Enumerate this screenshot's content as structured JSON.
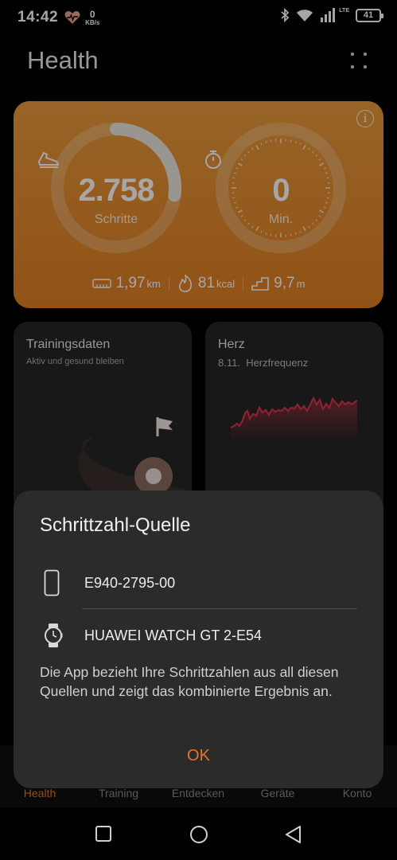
{
  "status_bar": {
    "time": "14:42",
    "net_speed_value": "0",
    "net_speed_unit": "KB/s",
    "network_type": "LTE",
    "battery_level": "41"
  },
  "header": {
    "title": "Health"
  },
  "activity": {
    "steps_value": "2.758",
    "steps_unit": "Schritte",
    "steps_ring_progress": 0.27,
    "minutes_value": "0",
    "minutes_unit": "Min.",
    "distance_value": "1,97",
    "distance_unit": "km",
    "calories_value": "81",
    "calories_unit": "kcal",
    "climb_value": "9,7",
    "climb_unit": "m",
    "accent_color": "#e48a2e"
  },
  "tiles": {
    "training_title": "Trainingsdaten",
    "training_subtitle": "Aktiv und gesund bleiben",
    "heart_title": "Herz",
    "heart_date": "8.11.",
    "heart_subtitle": "Herzfrequenz",
    "heart_line_color": "#d9344c"
  },
  "dialog": {
    "title": "Schrittzahl-Quelle",
    "sources": [
      {
        "icon": "phone-icon",
        "label": "E940-2795-00"
      },
      {
        "icon": "watch-icon",
        "label": "HUAWEI WATCH GT 2-E54"
      }
    ],
    "description": "Die App bezieht Ihre Schrittzahlen aus all diesen Quellen und zeigt das kombinierte Ergebnis an.",
    "ok_label": "OK"
  },
  "bottom_nav": {
    "items": [
      {
        "label": "Health",
        "active": true
      },
      {
        "label": "Training",
        "active": false
      },
      {
        "label": "Entdecken",
        "active": false
      },
      {
        "label": "Geräte",
        "active": false
      },
      {
        "label": "Konto",
        "active": false
      }
    ]
  }
}
